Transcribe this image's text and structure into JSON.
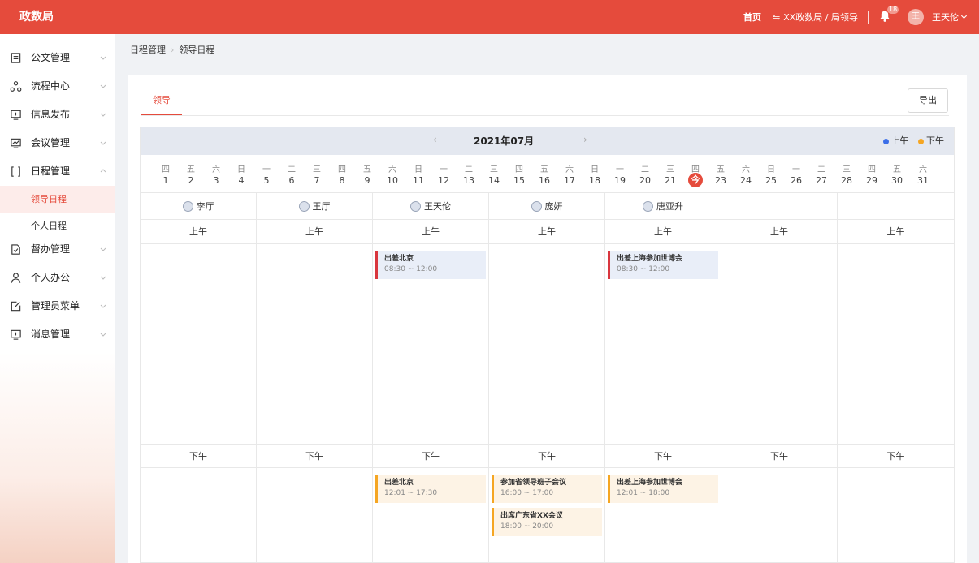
{
  "brand": "政数局",
  "topbar": {
    "home": "首页",
    "swap_icon": "⇋",
    "org": "XX政数局 / 局领导",
    "badge": "18",
    "avatar_initial": "王",
    "user": "王天伦"
  },
  "sidebar": {
    "items": [
      {
        "label": "公文管理",
        "icon": "document-icon"
      },
      {
        "label": "流程中心",
        "icon": "flow-icon"
      },
      {
        "label": "信息发布",
        "icon": "publish-icon"
      },
      {
        "label": "会议管理",
        "icon": "meeting-icon"
      },
      {
        "label": "日程管理",
        "icon": "schedule-icon"
      },
      {
        "label": "督办管理",
        "icon": "supervise-icon"
      },
      {
        "label": "个人办公",
        "icon": "person-icon"
      },
      {
        "label": "管理员菜单",
        "icon": "edit-icon"
      },
      {
        "label": "消息管理",
        "icon": "message-icon"
      }
    ],
    "subitems": [
      {
        "label": "领导日程",
        "active": true
      },
      {
        "label": "个人日程",
        "active": false
      }
    ]
  },
  "breadcrumb": {
    "first": "日程管理",
    "second": "领导日程"
  },
  "tab": "领导",
  "export_label": "导出",
  "calendar": {
    "month": "2021年07月",
    "legend_am": "上午",
    "legend_pm": "下午",
    "am_color": "#3b6ee8",
    "pm_color": "#f5a623",
    "today": "今",
    "days": [
      {
        "wd": "四",
        "dn": "1"
      },
      {
        "wd": "五",
        "dn": "2"
      },
      {
        "wd": "六",
        "dn": "3"
      },
      {
        "wd": "日",
        "dn": "4"
      },
      {
        "wd": "一",
        "dn": "5"
      },
      {
        "wd": "二",
        "dn": "6"
      },
      {
        "wd": "三",
        "dn": "7"
      },
      {
        "wd": "四",
        "dn": "8"
      },
      {
        "wd": "五",
        "dn": "9"
      },
      {
        "wd": "六",
        "dn": "10"
      },
      {
        "wd": "日",
        "dn": "11"
      },
      {
        "wd": "一",
        "dn": "12"
      },
      {
        "wd": "二",
        "dn": "13"
      },
      {
        "wd": "三",
        "dn": "14"
      },
      {
        "wd": "四",
        "dn": "15"
      },
      {
        "wd": "五",
        "dn": "16"
      },
      {
        "wd": "六",
        "dn": "17"
      },
      {
        "wd": "日",
        "dn": "18"
      },
      {
        "wd": "一",
        "dn": "19"
      },
      {
        "wd": "二",
        "dn": "20"
      },
      {
        "wd": "三",
        "dn": "21"
      },
      {
        "wd": "四",
        "dn": "今"
      },
      {
        "wd": "五",
        "dn": "23"
      },
      {
        "wd": "六",
        "dn": "24"
      },
      {
        "wd": "日",
        "dn": "25"
      },
      {
        "wd": "一",
        "dn": "26"
      },
      {
        "wd": "二",
        "dn": "27"
      },
      {
        "wd": "三",
        "dn": "28"
      },
      {
        "wd": "四",
        "dn": "29"
      },
      {
        "wd": "五",
        "dn": "30"
      },
      {
        "wd": "六",
        "dn": "31"
      }
    ],
    "am_label": "上午",
    "pm_label": "下午",
    "columns": [
      {
        "name": "李厅",
        "am": [],
        "pm": []
      },
      {
        "name": "王厅",
        "am": [],
        "pm": []
      },
      {
        "name": "王天伦",
        "am": [
          {
            "title": "出差北京",
            "time": "08:30 ~ 12:00"
          }
        ],
        "pm": [
          {
            "title": "出差北京",
            "time": "12:01 ~ 17:30"
          }
        ]
      },
      {
        "name": "庞妍",
        "am": [],
        "pm": [
          {
            "title": "参加省领导班子会议",
            "time": "16:00 ~ 17:00"
          },
          {
            "title": "出席广东省XX会议",
            "time": "18:00 ~ 20:00"
          }
        ]
      },
      {
        "name": "唐亚升",
        "am": [
          {
            "title": "出差上海参加世博会",
            "time": "08:30 ~ 12:00"
          }
        ],
        "pm": [
          {
            "title": "出差上海参加世博会",
            "time": "12:01 ~ 18:00"
          }
        ]
      },
      {
        "name": "",
        "am": [],
        "pm": []
      },
      {
        "name": "",
        "am": [],
        "pm": []
      }
    ]
  }
}
